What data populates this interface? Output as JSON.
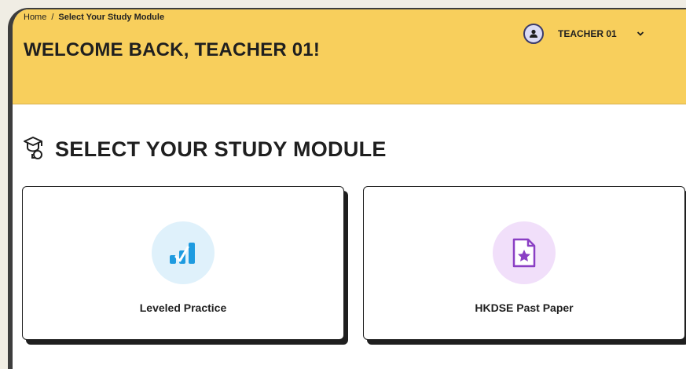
{
  "breadcrumb": {
    "home": "Home",
    "separator": "/",
    "current": "Select Your Study Module"
  },
  "header": {
    "welcome": "WELCOME BACK, TEACHER 01!",
    "user_name": "TEACHER 01",
    "avatar_icon": "user-icon",
    "menu_icon": "chevron-down-icon"
  },
  "section": {
    "title": "SELECT YOUR STUDY MODULE",
    "icon": "graduation-cap-icon"
  },
  "modules": [
    {
      "label": "Leveled Practice",
      "icon": "bar-chart-check-icon",
      "color": "#1e9be0"
    },
    {
      "label": "HKDSE Past Paper",
      "icon": "document-star-icon",
      "color": "#8a3fc4"
    }
  ],
  "colors": {
    "header_bg": "#f8cf5c",
    "page_bg": "#f0ede4"
  }
}
